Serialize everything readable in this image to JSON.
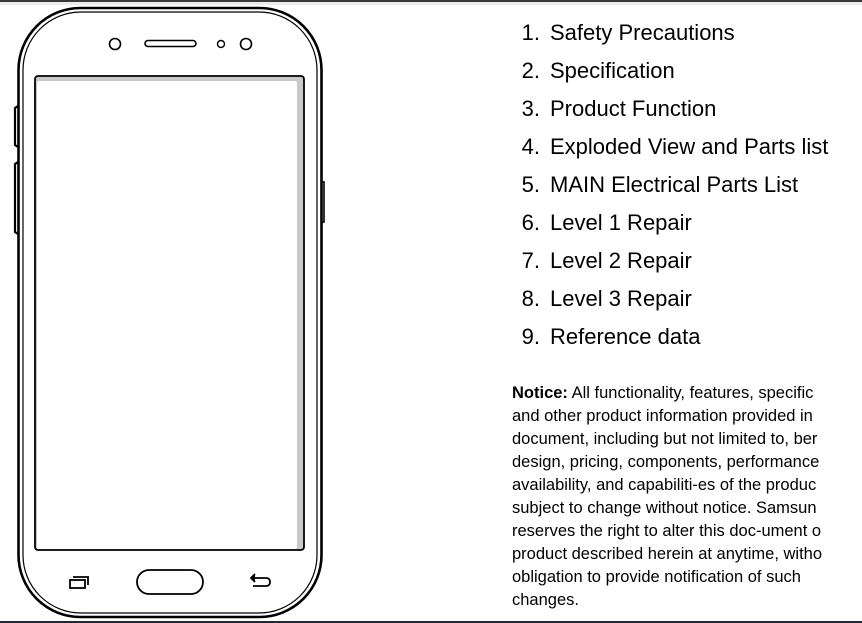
{
  "toc": {
    "items": [
      {
        "number": "1.",
        "label": "Safety Precautions"
      },
      {
        "number": "2.",
        "label": "Specification"
      },
      {
        "number": "3.",
        "label": "Product Function"
      },
      {
        "number": "4.",
        "label": "Exploded View and Parts list"
      },
      {
        "number": "5.",
        "label": "MAIN Electrical Parts List"
      },
      {
        "number": "6.",
        "label": "Level 1 Repair"
      },
      {
        "number": "7.",
        "label": "Level 2 Repair"
      },
      {
        "number": "8.",
        "label": "Level 3 Repair"
      },
      {
        "number": "9.",
        "label": "Reference data"
      }
    ]
  },
  "notice": {
    "heading": "Notice:",
    "lines": [
      " All functionality, features, specific",
      "and other product information provided in",
      "document, including but not limited to, ber",
      "design, pricing, components, performance",
      "availability, and capabiliti-es of the produc",
      "subject to change without notice. Samsun",
      "reserves the right to alter this doc-ument o",
      "product described herein at anytime, witho",
      "obligation to provide notification of such",
      "changes."
    ]
  },
  "illustration": {
    "subject": "smartphone front view",
    "icons": [
      "front-camera-icon",
      "speaker-grille-icon",
      "sensor-icon",
      "recent-apps-icon",
      "home-button-icon",
      "back-icon"
    ]
  }
}
